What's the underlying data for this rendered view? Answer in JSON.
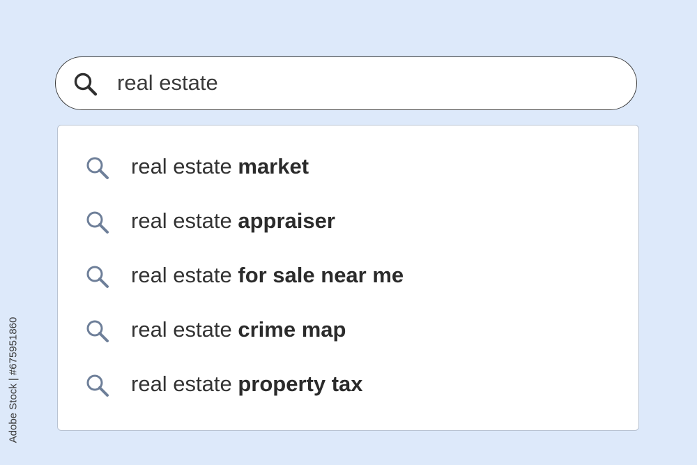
{
  "search": {
    "query": "real estate"
  },
  "suggestions": [
    {
      "prefix": "real estate ",
      "completion": "market"
    },
    {
      "prefix": "real estate ",
      "completion": "appraiser"
    },
    {
      "prefix": "real estate ",
      "completion": "for sale near me"
    },
    {
      "prefix": "real estate ",
      "completion": "crime map"
    },
    {
      "prefix": "real estate ",
      "completion": "property tax"
    }
  ],
  "credit": "Adobe Stock | #675951860",
  "icons": {
    "main_search": "search-icon",
    "suggestion": "search-icon"
  },
  "colors": {
    "background": "#dde9fa",
    "suggestion_icon": "#6e7f99",
    "search_icon": "#2f2f2f",
    "text": "#333333"
  }
}
